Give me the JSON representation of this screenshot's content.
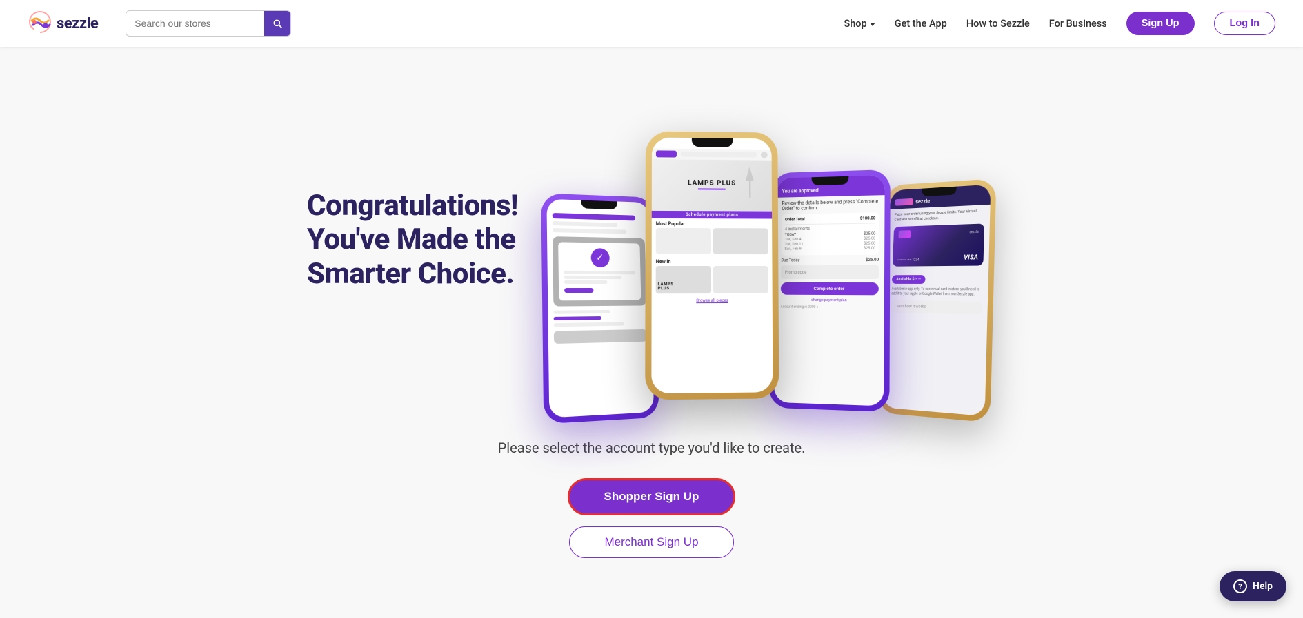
{
  "brand": {
    "name": "sezzle",
    "logo_alt": "Sezzle logo"
  },
  "navbar": {
    "search_placeholder": "Search our stores",
    "shop_label": "Shop",
    "get_app_label": "Get the App",
    "how_to_label": "How to Sezzle",
    "for_business_label": "For Business",
    "signup_label": "Sign Up",
    "login_label": "Log In"
  },
  "hero": {
    "title_line1": "Congratulations!",
    "title_line2": "You've Made the",
    "title_line3": "Smarter Choice."
  },
  "lower": {
    "subtitle": "Please select the account type you'd like to create.",
    "shopper_signup_label": "Shopper Sign Up",
    "merchant_signup_label": "Merchant Sign Up"
  },
  "help": {
    "label": "Help"
  },
  "colors": {
    "purple": "#7b2fcc",
    "dark_purple": "#2d2260",
    "red_border": "#e03030"
  }
}
